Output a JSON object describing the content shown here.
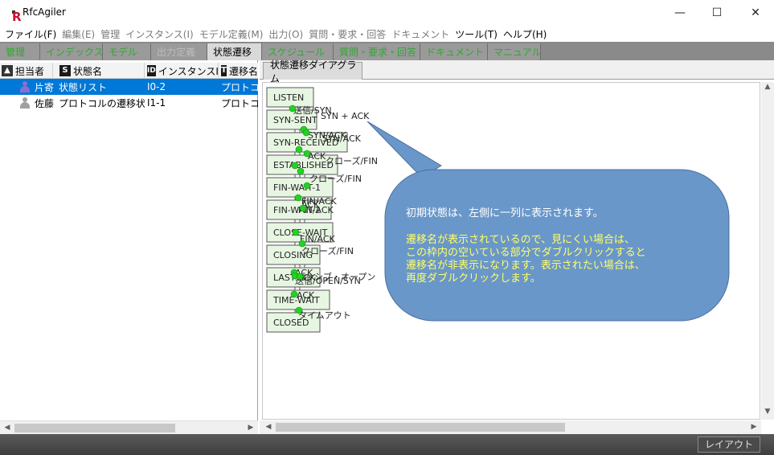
{
  "window": {
    "title": "RfcAgiler",
    "app_icon": "R",
    "controls": {
      "minimize": "—",
      "maximize": "☐",
      "close": "✕"
    }
  },
  "menu": [
    {
      "label": "ファイル(F)",
      "enabled": true
    },
    {
      "label": "編集(E)",
      "enabled": false
    },
    {
      "label": "管理",
      "enabled": false
    },
    {
      "label": "インスタンス(I)",
      "enabled": false
    },
    {
      "label": "モデル定義(M)",
      "enabled": false
    },
    {
      "label": "出力(O)",
      "enabled": false
    },
    {
      "label": "質問・要求・回答",
      "enabled": false
    },
    {
      "label": "ドキュメント",
      "enabled": false
    },
    {
      "label": "ツール(T)",
      "enabled": true
    },
    {
      "label": "ヘルプ(H)",
      "enabled": true
    }
  ],
  "tabs": [
    {
      "label": "管理",
      "state": "normal"
    },
    {
      "label": "インデックス",
      "state": "normal"
    },
    {
      "label": "モデル",
      "state": "normal"
    },
    {
      "label": "出力定義",
      "state": "dim"
    },
    {
      "label": "状態遷移",
      "state": "active"
    },
    {
      "label": "スケジュール",
      "state": "normal"
    },
    {
      "label": "質問・要求・回答",
      "state": "normal"
    },
    {
      "label": "ドキュメント",
      "state": "normal"
    },
    {
      "label": "マニュアル",
      "state": "normal"
    }
  ],
  "list": {
    "columns": [
      {
        "icon": "person-icon",
        "label": "担当者"
      },
      {
        "icon": "S",
        "label": "状態名"
      },
      {
        "icon": "ID",
        "label": "インスタンスID"
      },
      {
        "icon": "T",
        "label": "遷移名"
      }
    ],
    "rows": [
      {
        "assignee": "片寄",
        "state_name": "状態リスト",
        "instance_id": "I0-2",
        "transition": "プロトコル",
        "selected": true,
        "avatar_color": "#8a6fd0"
      },
      {
        "assignee": "佐藤",
        "state_name": "プロトコルの遷移状態",
        "instance_id": "I1-1",
        "transition": "プロトコル",
        "selected": false,
        "avatar_color": "#a0a0a0"
      }
    ]
  },
  "diagram": {
    "tab_label": "状態遷移ダイアグラム",
    "states": [
      "LISTEN",
      "SYN-SENT",
      "SYN-RECEIVED",
      "ESTABLISHED",
      "FIN-WAIT-1",
      "FIN-WAIT-2",
      "CLOSE-WAIT",
      "CLOSING",
      "LAST-ACK",
      "TIME-WAIT",
      "CLOSED"
    ],
    "transition_labels": [
      "送信/SYN",
      "SYN + ACK",
      "SYN/ACK",
      "SYN/ACK",
      "ACK",
      "クローズ/FIN",
      "クローズ/FIN",
      "FIN/ACK",
      "ACK",
      "FIN/ACK",
      "FIN/ACK",
      "クローズ/FIN",
      "ACK",
      "パッシブ・オープン",
      "送信/OPEN/SYN",
      "ACK",
      "タイムアウト"
    ],
    "callout": {
      "line1": "初期状態は、左側に一列に表示されます。",
      "line2": "遷移名が表示されているので、見にくい場合は、",
      "line3": "この枠内の空いている部分でダブルクリックすると",
      "line4": "遷移名が非表示になります。表示されたい場合は、",
      "line5": "再度ダブルクリックします。",
      "fill": "#6a97c9",
      "line1_color": "#ffffff",
      "text_color": "#ffff66"
    }
  },
  "statusbar": {
    "layout_button": "レイアウト"
  },
  "colors": {
    "accent_tab_text": "#2fa82f",
    "selection": "#0078d7",
    "state_fill": "#e7f6e2",
    "node_dot": "#22d322"
  }
}
